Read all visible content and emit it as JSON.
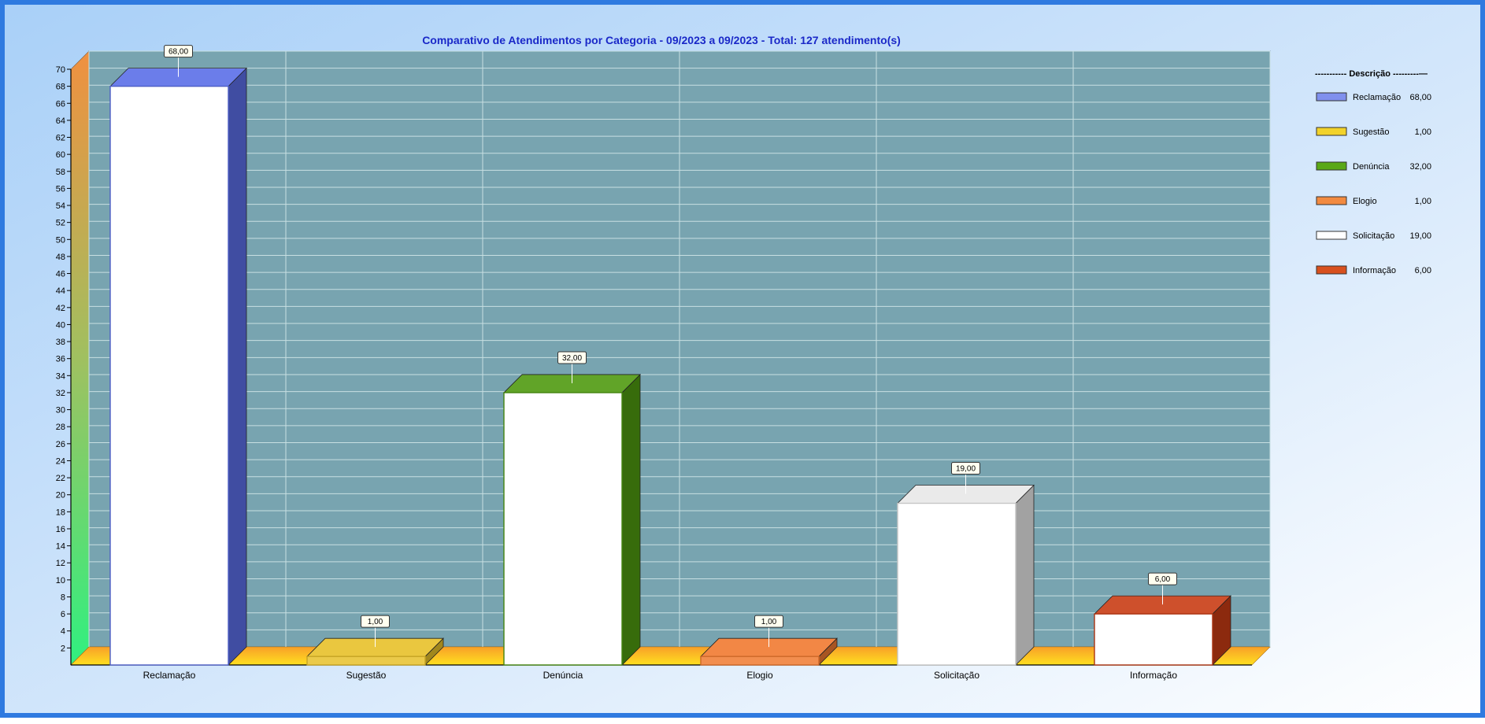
{
  "chart_data": {
    "type": "bar",
    "title": "Comparativo de Atendimentos por Categoria - 09/2023 a 09/2023 - Total: 127 atendimento(s)",
    "xlabel": "",
    "ylabel": "",
    "categories": [
      "Reclamação",
      "Sugestão",
      "Denúncia",
      "Elogio",
      "Solicitação",
      "Informação"
    ],
    "values": [
      68,
      1,
      32,
      1,
      19,
      6
    ],
    "value_labels": [
      "68,00",
      "1,00",
      "32,00",
      "1,00",
      "19,00",
      "6,00"
    ],
    "colors": [
      "#5b6ee8",
      "#e8c12a",
      "#4f9a10",
      "#f07a30",
      "#e8e8e8",
      "#c83c14"
    ],
    "ylim": [
      0,
      70
    ],
    "y_ticks": [
      "2",
      "4",
      "6",
      "8",
      "10",
      "12",
      "14",
      "16",
      "18",
      "20",
      "22",
      "24",
      "26",
      "28",
      "30",
      "32",
      "34",
      "36",
      "38",
      "40",
      "42",
      "44",
      "46",
      "48",
      "50",
      "52",
      "54",
      "56",
      "58",
      "60",
      "62",
      "64",
      "66",
      "68",
      "70"
    ],
    "grid": true,
    "legend_position": "right",
    "legend": {
      "title": "----------- Descrição ---------—",
      "entries": [
        {
          "name": "Reclamação",
          "value": "68,00",
          "color": "#8090ee"
        },
        {
          "name": "Sugestão",
          "value": "1,00",
          "color": "#f2d22a"
        },
        {
          "name": "Denúncia",
          "value": "32,00",
          "color": "#5aa816"
        },
        {
          "name": "Elogio",
          "value": "1,00",
          "color": "#f28a40"
        },
        {
          "name": "Solicitação",
          "value": "19,00",
          "color": "#ffffff"
        },
        {
          "name": "Informação",
          "value": "6,00",
          "color": "#d8501e"
        }
      ]
    }
  }
}
